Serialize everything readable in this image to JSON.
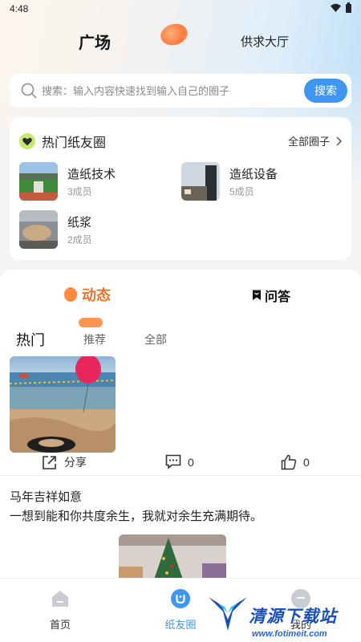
{
  "status_bar": {
    "time": "4:48"
  },
  "header": {
    "title": "广场",
    "tab_supply": "供求大厅"
  },
  "search": {
    "placeholder": "搜索：输入内容快速找到输入自己的圈子",
    "button_label": "搜索"
  },
  "circles": {
    "title": "热门纸友圈",
    "all_label": "全部圈子",
    "items": [
      {
        "name": "造纸技术",
        "members": "3成员"
      },
      {
        "name": "造纸设备",
        "members": "5成员"
      },
      {
        "name": "纸浆",
        "members": "2成员"
      }
    ]
  },
  "feed": {
    "tabs": {
      "dynamic": "动态",
      "qa": "问答"
    },
    "sub_tabs": [
      "热门",
      "推荐",
      "全部"
    ],
    "post": {
      "share_label": "分享",
      "comment_count": "0",
      "like_count": "0",
      "title": "马年吉祥如意",
      "text": "一想到能和你共度余生，我就对余生充满期待。"
    }
  },
  "bottom_nav": {
    "items": [
      "首页",
      "纸友圈",
      "我的"
    ]
  },
  "watermark": {
    "text": "清源下载站",
    "url": "www.fotimeit.com"
  },
  "colors": {
    "accent": "#3d96f2",
    "orange": "#ff8a3d",
    "badge_green": "#c4eb70"
  }
}
